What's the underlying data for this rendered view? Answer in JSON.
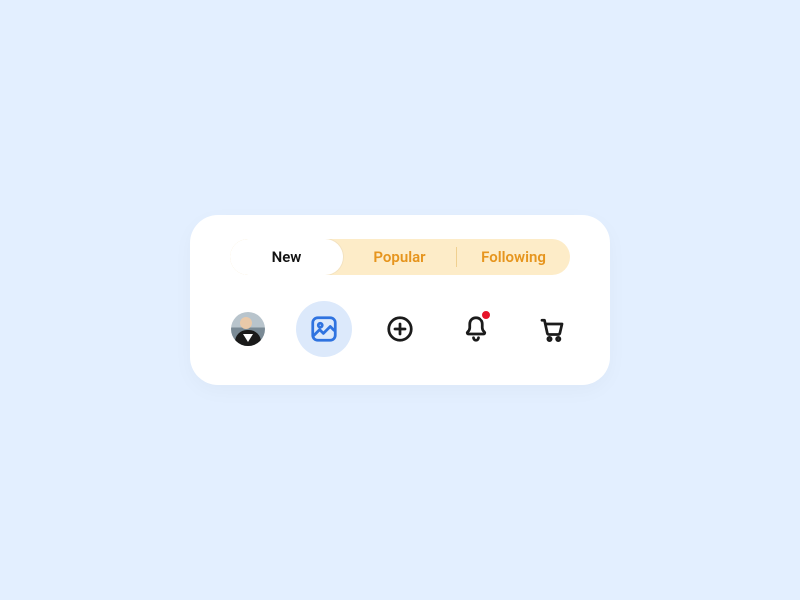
{
  "tabs": {
    "new": "New",
    "popular": "Popular",
    "following": "Following",
    "active": "new"
  },
  "nav": {
    "active": "gallery",
    "has_notification": true
  }
}
